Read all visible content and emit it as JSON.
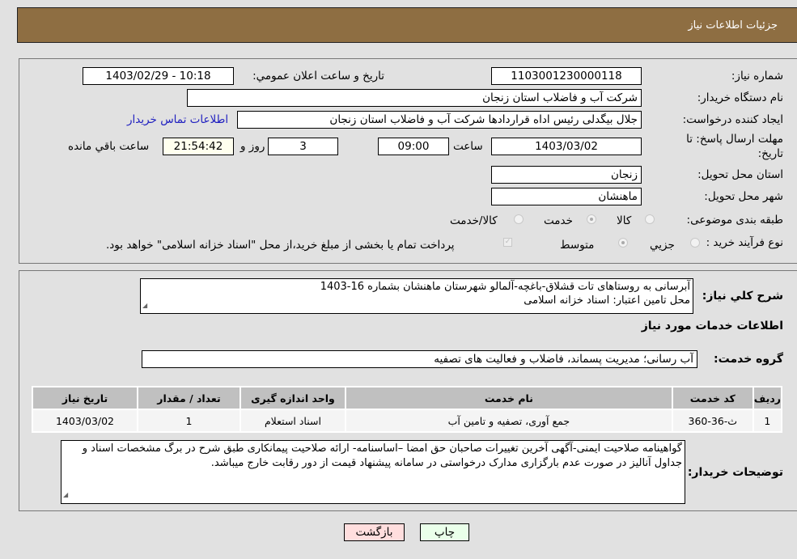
{
  "header": {
    "title": "جزئيات اطلاعات نياز"
  },
  "form": {
    "need_number": {
      "label": "شماره نياز:",
      "value": "1103001230000118"
    },
    "announce_datetime": {
      "label": "تاريخ و ساعت اعلان عمومي:",
      "value": "1403/02/29 - 10:18"
    },
    "buyer_org": {
      "label": "نام دستگاه خريدار:",
      "value": "شرکت آب و فاضلاب استان زنجان"
    },
    "requester": {
      "label": "ايجاد کننده درخواست:",
      "value": "جلال بيگدلی رئيس اداه قراردادها شرکت آب و فاضلاب استان زنجان"
    },
    "buyer_contact_link": "اطلاعات تماس خريدار",
    "deadline": {
      "label_line1": "مهلت ارسال پاسخ: تا",
      "label_line2": "تاريخ:",
      "date": "1403/03/02",
      "time_label": "ساعت",
      "time": "09:00",
      "days": "3",
      "days_label": "روز و",
      "remaining": "21:54:42",
      "remaining_label": "ساعت باقي مانده"
    },
    "province": {
      "label": "استان محل تحويل:",
      "value": "زنجان"
    },
    "city": {
      "label": "شهر محل تحويل:",
      "value": "ماهنشان"
    },
    "category": {
      "label": "طبقه بندی موضوعی:",
      "options": [
        "کالا",
        "خدمت",
        "کالا/خدمت"
      ],
      "selected": "خدمت"
    },
    "process_type": {
      "label": "نوع فرآيند خريد :",
      "options": [
        "جزيي",
        "متوسط"
      ],
      "selected": "متوسط",
      "treasury_checkbox_label": "پرداخت تمام يا بخشی از مبلغ خريد،از محل \"اسناد خزانه اسلامی\" خواهد بود.",
      "treasury_checked": true
    }
  },
  "details": {
    "description_label": "شرح کلي نياز:",
    "description_line1": "آبرسانی به روستاهای تات قشلاق-باغچه-آلمالو شهرستان ماهنشان بشماره 16-1403",
    "description_line2": "محل تامين اعتبار: اسناد خزانه اسلامی",
    "services_heading": "اطلاعات خدمات مورد نياز",
    "service_group_label": "گروه خدمت:",
    "service_group_value": "آب رسانی؛ مديريت پسماند، فاضلاب و فعاليت های تصفيه",
    "table": {
      "headers": [
        "رديف",
        "کد خدمت",
        "نام خدمت",
        "واحد اندازه گيری",
        "تعداد / مقدار",
        "تاريخ نياز"
      ],
      "rows": [
        [
          "1",
          "ث-36-360",
          "جمع آوری، تصفيه و تامين آب",
          "اسناد استعلام",
          "1",
          "1403/03/02"
        ]
      ]
    },
    "buyer_notes_label": "توضيحات خريدار:",
    "buyer_notes": "گواهينامه صلاحيت ايمنی-آگهی آخرين تغييرات صاحبان حق امضا –اساسنامه- ارائه صلاحيت پيمانکاری طبق شرح در برگ مشخصات اسناد و جداول آناليز در صورت عدم بارگزاری مدارک درخواستی در سامانه پيشنهاد قيمت از دور رقابت خارج ميباشد."
  },
  "buttons": {
    "print": "چاپ",
    "back": "بازگشت"
  },
  "colors": {
    "header_bg": "#8e6e42",
    "print_bg": "#eaffea",
    "back_bg": "#ffdede",
    "link": "#2020c0"
  }
}
